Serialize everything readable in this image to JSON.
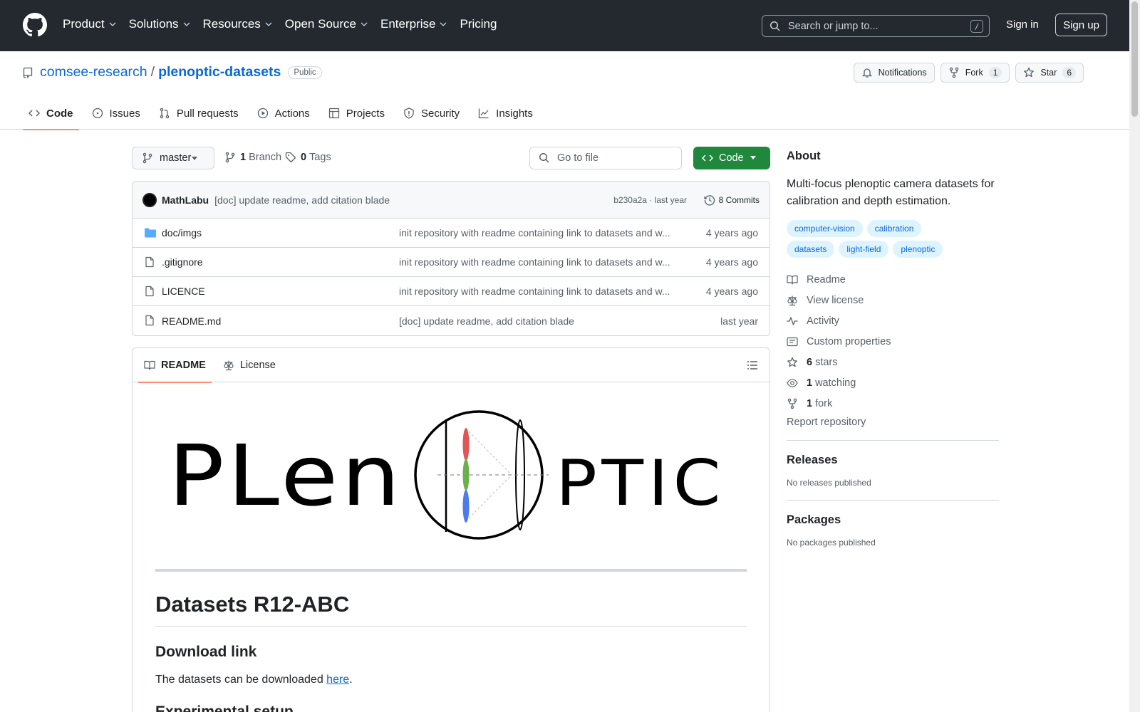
{
  "header": {
    "nav": [
      "Product",
      "Solutions",
      "Resources",
      "Open Source",
      "Enterprise",
      "Pricing"
    ],
    "search_placeholder": "Search or jump to...",
    "search_shortcut": "/",
    "signin": "Sign in",
    "signup": "Sign up"
  },
  "repo": {
    "owner": "comsee-research",
    "separator": "/",
    "name": "plenoptic-datasets",
    "visibility": "Public",
    "notifications_label": "Notifications",
    "fork_label": "Fork",
    "fork_count": "1",
    "star_label": "Star",
    "star_count": "6",
    "tabs": [
      "Code",
      "Issues",
      "Pull requests",
      "Actions",
      "Projects",
      "Security",
      "Insights"
    ]
  },
  "branchbar": {
    "branch": "master",
    "branch_count": "1",
    "branch_label": "Branch",
    "tag_count": "0",
    "tag_label": "Tags",
    "goto_placeholder": "Go to file",
    "code_label": "Code"
  },
  "commit": {
    "author": "MathLabu",
    "message": "[doc] update readme, add citation blade",
    "hash_age": "b230a2a · last year",
    "count_label": "8 Commits"
  },
  "files": [
    {
      "name": "doc/imgs",
      "type": "folder",
      "message": "init repository with readme containing link to datasets and w...",
      "age": "4 years ago"
    },
    {
      "name": ".gitignore",
      "type": "file",
      "message": "init repository with readme containing link to datasets and w...",
      "age": "4 years ago"
    },
    {
      "name": "LICENCE",
      "type": "file",
      "message": "init repository with readme containing link to datasets and w...",
      "age": "4 years ago"
    },
    {
      "name": "README.md",
      "type": "file",
      "message": "[doc] update readme, add citation blade",
      "age": "last year"
    }
  ],
  "readme": {
    "tabs": [
      "README",
      "License"
    ],
    "logo_text_left": "PLen",
    "logo_text_right": "PTIC",
    "h1": "Datasets R12-ABC",
    "h2_download": "Download link",
    "download_text": "The datasets can be downloaded ",
    "download_link": "here",
    "download_end": ".",
    "h2_setup": "Experimental setup"
  },
  "about": {
    "title": "About",
    "description": "Multi-focus plenoptic camera datasets for calibration and depth estimation.",
    "topics": [
      "computer-vision",
      "calibration",
      "datasets",
      "light-field",
      "plenoptic"
    ],
    "links": {
      "readme": "Readme",
      "license": "View license",
      "activity": "Activity",
      "custom": "Custom properties",
      "stars_count": "6",
      "stars_label": "stars",
      "watching_count": "1",
      "watching_label": "watching",
      "fork_count": "1",
      "fork_label": "fork"
    },
    "report": "Report repository"
  },
  "releases": {
    "title": "Releases",
    "empty": "No releases published"
  },
  "packages": {
    "title": "Packages",
    "empty": "No packages published"
  },
  "colors": {
    "header_bg": "#24292f",
    "link": "#0969da",
    "green": "#1f883d",
    "active_tab": "#fd8c73"
  }
}
